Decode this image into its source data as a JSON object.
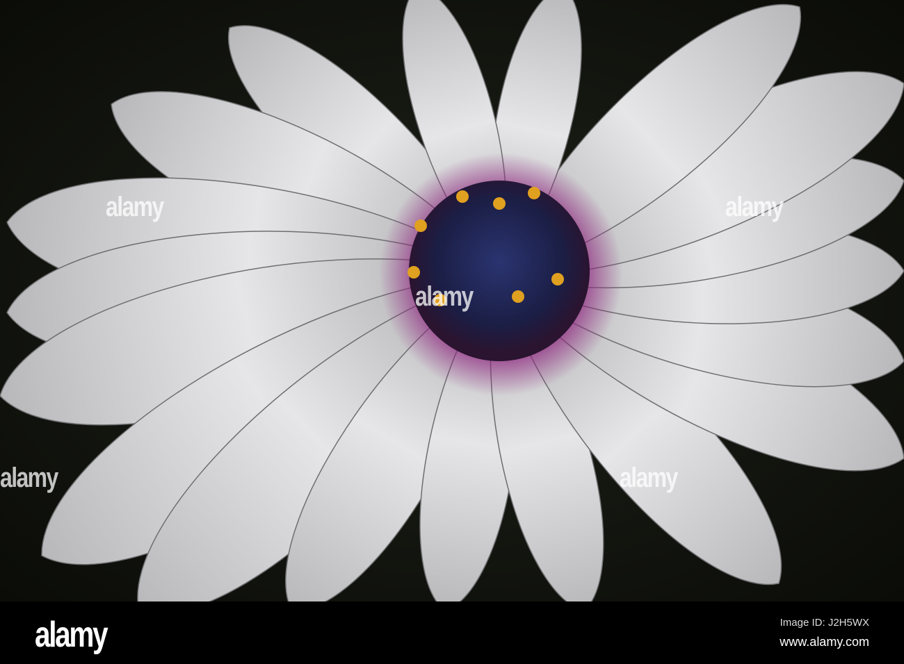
{
  "image": {
    "subject": "white daisy flower",
    "colors": {
      "background": "#14150f",
      "petal": "#d9d9d9",
      "petal_shadow": "#9a9a9a",
      "center": "#1f2553",
      "ring": "#8a1f7a",
      "pollen": "#e0a020"
    }
  },
  "watermark": {
    "text": "alamy"
  },
  "footer": {
    "logo": "alamy",
    "image_id": "Image ID: J2H5WX",
    "website": "www.alamy.com"
  }
}
